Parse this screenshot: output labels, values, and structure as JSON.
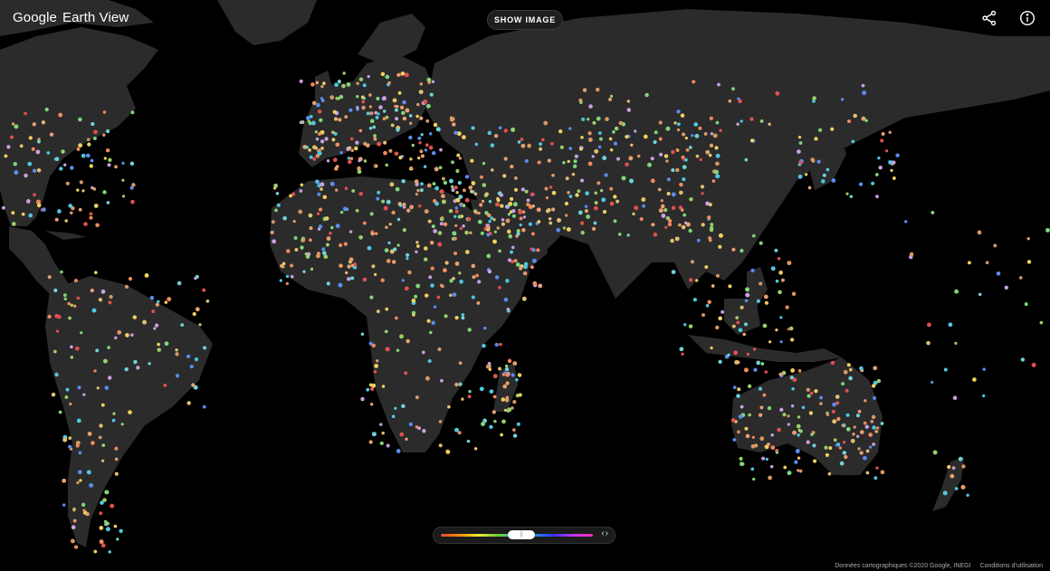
{
  "header": {
    "brand_google": "Google",
    "brand_product": "Earth View",
    "show_image_label": "SHOW IMAGE"
  },
  "icons": {
    "share": "share-icon",
    "info": "info-icon"
  },
  "slider": {
    "thumb_glyph": "||",
    "arrows": "‹›",
    "value_fraction": 0.53
  },
  "footer": {
    "attribution": "Données cartographiques ©2020 Google, INEGI",
    "terms": "Conditions d'utilisation"
  },
  "colors": {
    "background": "#000000",
    "land": "#2b2b2b",
    "dot_palette": [
      "#e8a070",
      "#d89866",
      "#6fd3d6",
      "#4ec8e0",
      "#7fd67a",
      "#f08a5d",
      "#e0c070",
      "#9ccf6a",
      "#5b8df0",
      "#e15050",
      "#c9a0e0",
      "#f0d060"
    ]
  }
}
